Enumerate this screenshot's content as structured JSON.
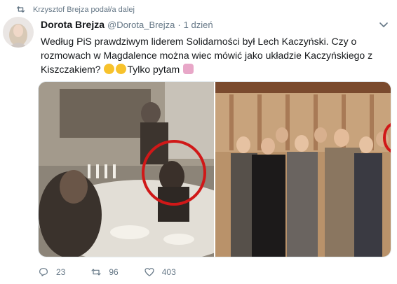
{
  "retweet": {
    "icon": "retweet-icon",
    "text": "Krzysztof Brejza podał/a dalej"
  },
  "tweet": {
    "author_name": "Dorota Brejza",
    "handle": "@Dorota_Brejza",
    "separator": "·",
    "time": "1 dzień",
    "text_main": "Według PiS prawdziwym liderem Solidarności był Lech Kaczyński. Czy o rozmowach w Magdalence można wiec mówić jako układzie Kaczyńskiego z Kiszczakiem?",
    "text_tail": "Tylko pytam",
    "emojis": [
      "thinking-face-emoji",
      "winking-face-emoji",
      "person-shrugging-emoji"
    ]
  },
  "media": [
    {
      "name": "photo-meeting-table",
      "icon": "red-circle-highlight"
    },
    {
      "name": "photo-group-portrait",
      "icon": "red-circle-highlight"
    }
  ],
  "actions": {
    "reply_count": "23",
    "retweet_count": "96",
    "like_count": "403"
  },
  "colors": {
    "accent_red": "#d01818",
    "muted_gray": "#657786",
    "text_dark": "#14171a",
    "emoji_yellow": "#f7c22c"
  }
}
